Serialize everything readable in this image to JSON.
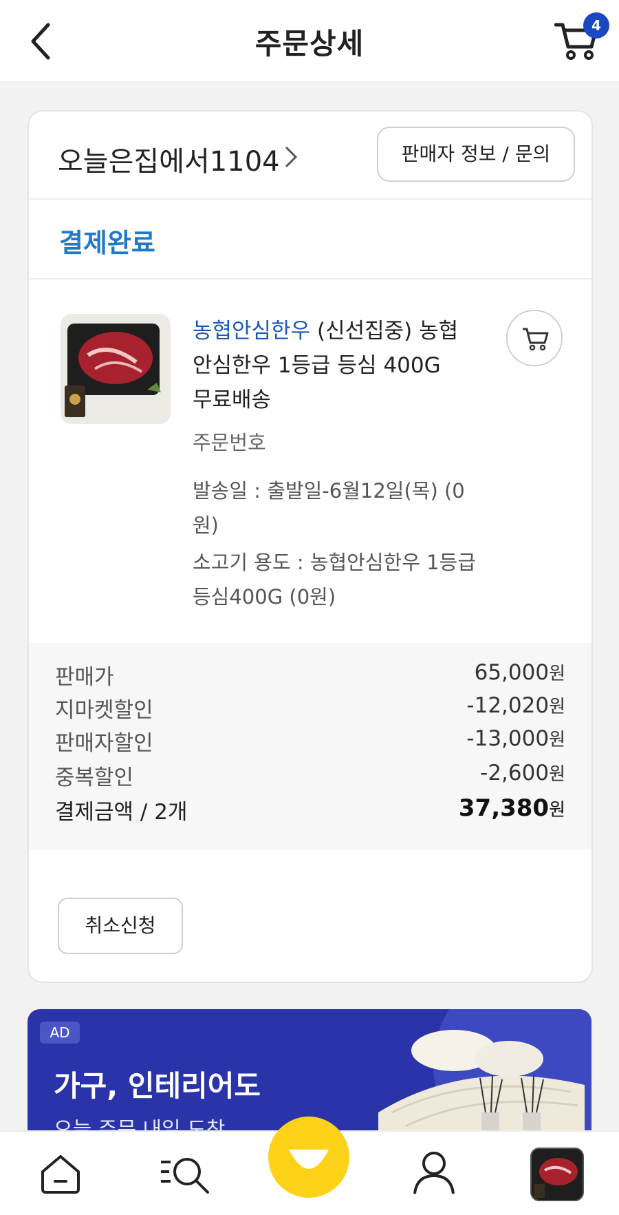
{
  "header": {
    "title": "주문상세",
    "cart_count": "4"
  },
  "seller": {
    "name": "오늘은집에서1104",
    "info_button": "판매자 정보 / 문의"
  },
  "order_status": "결제완료",
  "product": {
    "brand": "농협안심한우",
    "title_rest": " (신선집중) 농협안심한우 1등급 등심 400G 무료배송",
    "order_number_label": "주문번호",
    "ship_text": "발송일 : 출발일-6월12일(목) (0원)",
    "usage_text": "소고기 용도 : 농협안심한우 1등급 등심400G (0원)"
  },
  "prices": {
    "unit": "원",
    "rows": [
      {
        "label": "판매가",
        "value": "65,000"
      },
      {
        "label": "지마켓할인",
        "value": "-12,020"
      },
      {
        "label": "판매자할인",
        "value": "-13,000"
      },
      {
        "label": "중복할인",
        "value": "-2,600"
      }
    ],
    "total": {
      "label": "결제금액 / 2개",
      "value": "37,380"
    }
  },
  "cancel_button": "취소신청",
  "ad": {
    "tag": "AD",
    "title": "가구, 인테리어도",
    "subtitle": "오늘 주문 내일 도착"
  },
  "colors": {
    "accent_blue": "#1f78c8",
    "badge_blue": "#1a47c2",
    "ad_bg": "#2a34a8",
    "smile_yellow": "#ffd21a"
  }
}
